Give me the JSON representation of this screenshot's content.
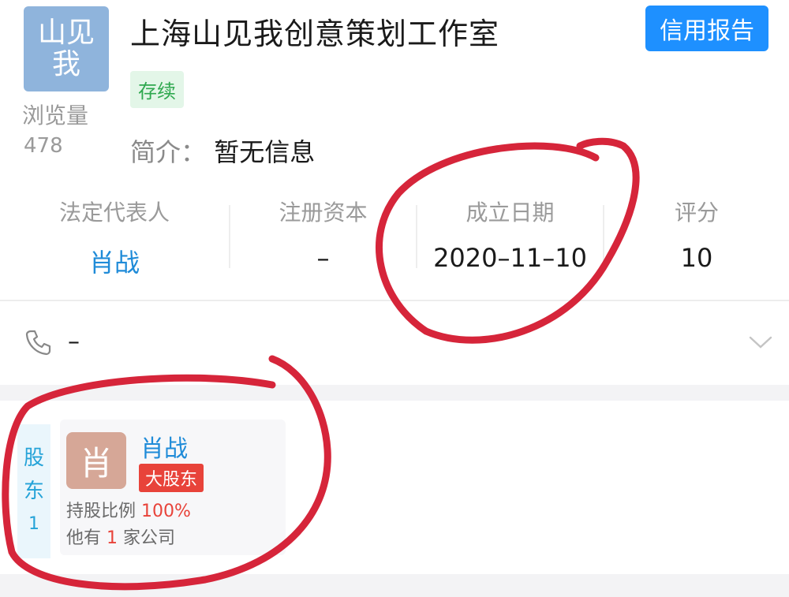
{
  "company": {
    "logo_text": "山见我",
    "name": "上海山见我创意策划工作室",
    "status": "存续",
    "intro_label": "简介：",
    "intro_value": "暂无信息"
  },
  "views": {
    "label": "浏览量",
    "count": "478"
  },
  "credit_report": {
    "label": "信用报告"
  },
  "stats": [
    {
      "label": "法定代表人",
      "value": "肖战"
    },
    {
      "label": "注册资本",
      "value": "–"
    },
    {
      "label": "成立日期",
      "value": "2020–11–10"
    },
    {
      "label": "评分",
      "value": "10"
    }
  ],
  "phone": {
    "value": "–"
  },
  "shareholders": {
    "tab_chars": [
      "股",
      "东",
      "1"
    ],
    "holder": {
      "avatar": "肖",
      "name": "肖战",
      "badge": "大股东",
      "ratio_label": "持股比例",
      "ratio_value": "100%",
      "companies_prefix": "他有",
      "companies_count": "1",
      "companies_suffix": "家公司"
    }
  },
  "colors": {
    "accent": "#1e90ff",
    "link": "#1f8bd8",
    "status_green": "#2fa84f",
    "highlight_red": "#e8433a",
    "annotation_red": "#d6253a"
  }
}
